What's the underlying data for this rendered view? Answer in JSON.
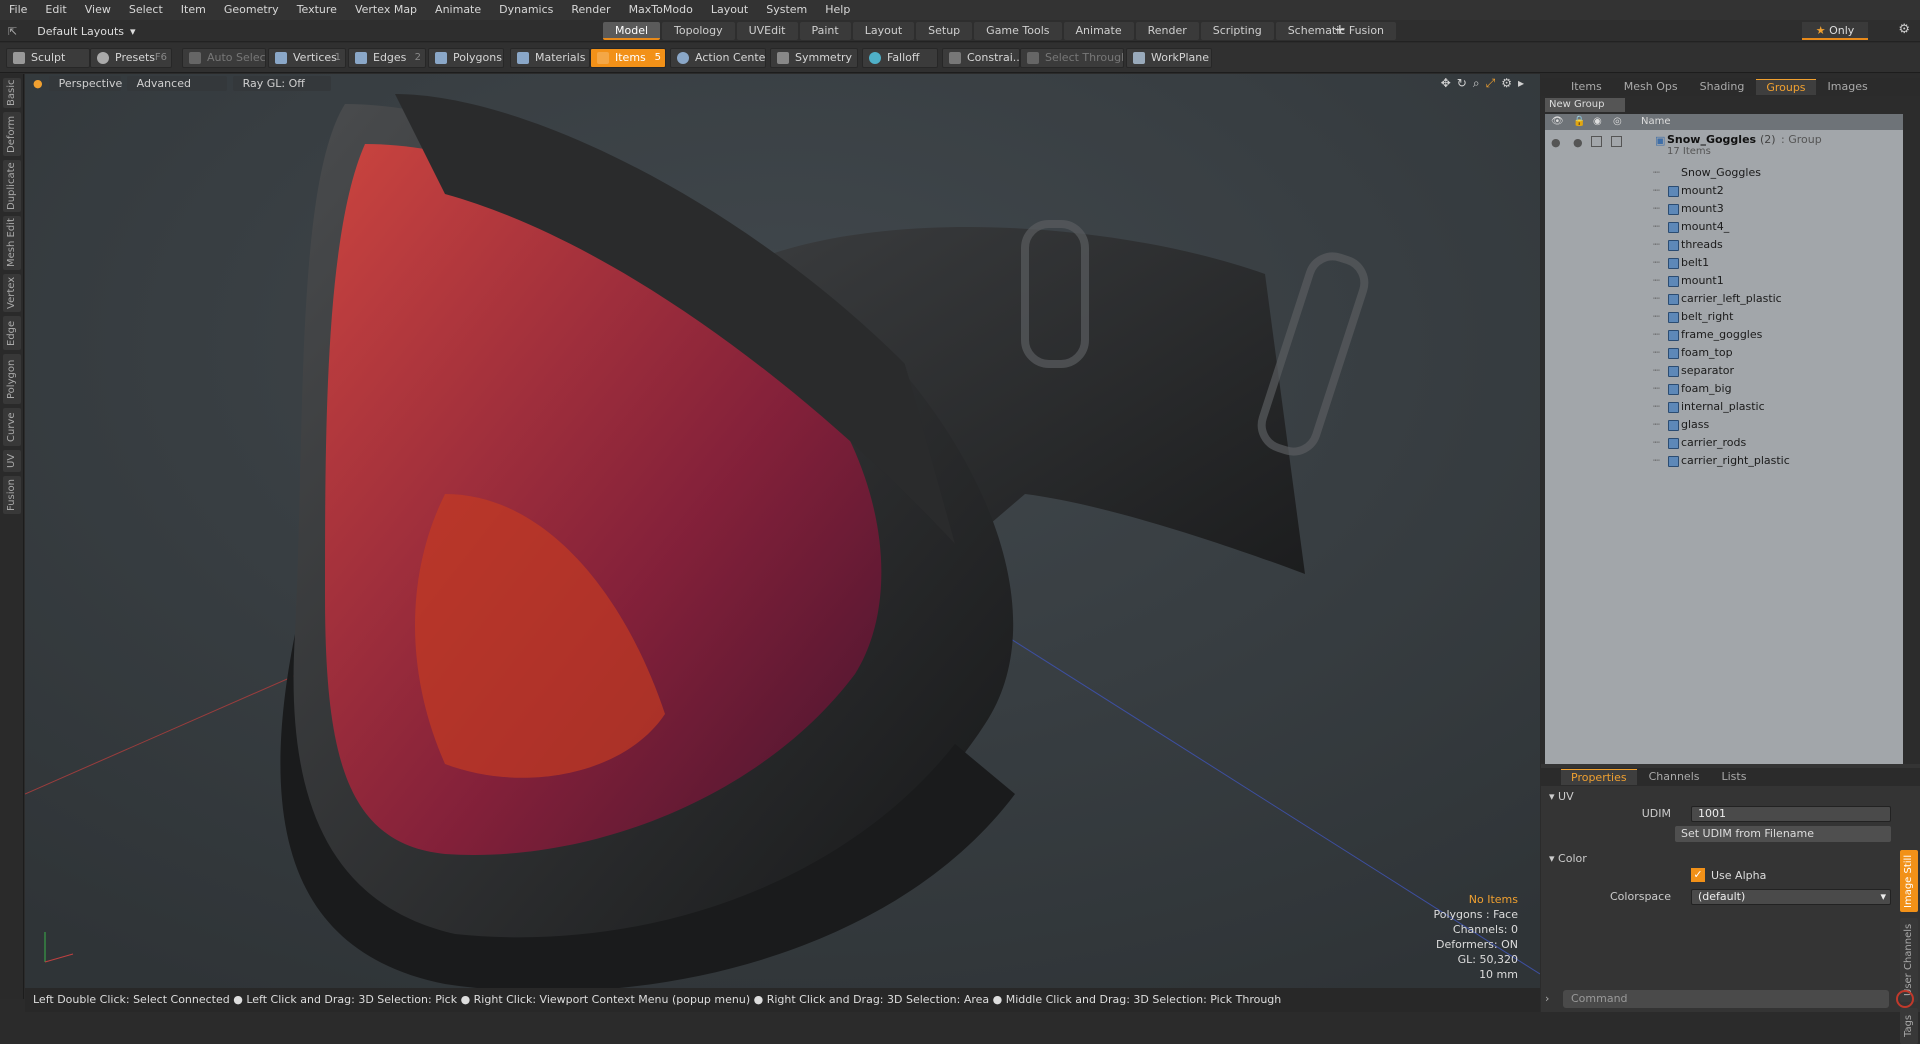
{
  "menu": [
    "File",
    "Edit",
    "View",
    "Select",
    "Item",
    "Geometry",
    "Texture",
    "Vertex Map",
    "Animate",
    "Dynamics",
    "Render",
    "MaxToModo",
    "Layout",
    "System",
    "Help"
  ],
  "layouts": {
    "selector": "Default Layouts",
    "only": "Only",
    "tabs": [
      "Model",
      "Topology",
      "UVEdit",
      "Paint",
      "Layout",
      "Setup",
      "Game Tools",
      "Animate",
      "Render",
      "Scripting",
      "Schematic Fusion"
    ],
    "active_tab": "Model"
  },
  "toolbar": {
    "sculpt": "Sculpt",
    "presets": "Presets",
    "presets_key": "F6",
    "auto_select": "Auto Select",
    "vertices": "Vertices",
    "vertices_key": "1",
    "edges": "Edges",
    "edges_key": "2",
    "polygons": "Polygons",
    "materials": "Materials",
    "items": "Items",
    "items_key": "5",
    "action_center": "Action Center",
    "symmetry": "Symmetry",
    "falloff": "Falloff",
    "constraints": "Constrai...",
    "select_through": "Select Through",
    "workplane": "WorkPlane"
  },
  "left_tabs": [
    "Basic",
    "Deform",
    "Duplicate",
    "Mesh Edit",
    "Vertex",
    "Edge",
    "Polygon",
    "Curve",
    "UV",
    "Fusion"
  ],
  "viewport": {
    "view": "Perspective",
    "shading": "Advanced",
    "raygl": "Ray GL: Off"
  },
  "info": {
    "items": "No Items",
    "polygons": "Polygons : Face",
    "channels": "Channels: 0",
    "deformers": "Deformers: ON",
    "gl": "GL: 50,320",
    "scale": "10 mm"
  },
  "status": "Left Double Click: Select Connected ● Left Click and Drag: 3D Selection: Pick ● Right Click: Viewport Context Menu (popup menu) ● Right Click and Drag: 3D Selection: Area ● Middle Click and Drag: 3D Selection: Pick Through",
  "panel_tabs": [
    "Items",
    "Mesh Ops",
    "Shading",
    "Groups",
    "Images"
  ],
  "active_panel_tab": "Groups",
  "groups": {
    "new_group": "New Group",
    "col_name": "Name",
    "group_name": "Snow_Goggles",
    "group_count": "(2)",
    "group_type": ": Group",
    "group_items": "17 Items",
    "items": [
      "Snow_Goggles",
      "mount2",
      "mount3",
      "mount4_",
      "threads",
      "belt1",
      "mount1",
      "carrier_left_plastic",
      "belt_right",
      "frame_goggles",
      "foam_top",
      "separator",
      "foam_big",
      "internal_plastic",
      "glass",
      "carrier_rods",
      "carrier_right_plastic"
    ]
  },
  "prop_tabs": [
    "Properties",
    "Channels",
    "Lists"
  ],
  "properties": {
    "uv_section": "UV",
    "udim_label": "UDIM",
    "udim_value": "1001",
    "set_udim": "Set UDIM from Filename",
    "color_section": "Color",
    "use_alpha": "Use Alpha",
    "colorspace_label": "Colorspace",
    "colorspace_value": "(default)"
  },
  "side_tabs": [
    "Image Still",
    "User Channels",
    "Tags"
  ],
  "command_placeholder": "Command",
  "colors": {
    "accent": "#f29118",
    "lens": "#b8282e",
    "viewport_bg": "#3b4044"
  }
}
